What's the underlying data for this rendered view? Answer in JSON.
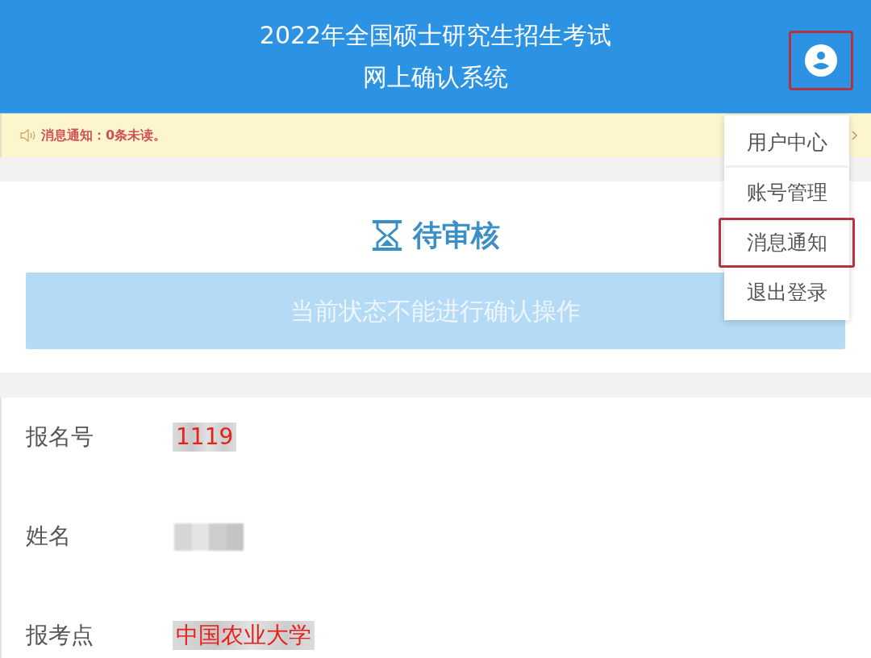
{
  "header": {
    "title_lines": [
      "2022年全国硕士研究生招生考试",
      "网上确认系统"
    ],
    "user_button": {
      "highlighted": true
    }
  },
  "notice": {
    "text": "消息通知：0条未读。"
  },
  "user_menu": {
    "items": [
      {
        "label": "用户中心",
        "highlighted": false
      },
      {
        "label": "账号管理",
        "highlighted": false
      },
      {
        "label": "消息通知",
        "highlighted": true
      },
      {
        "label": "退出登录",
        "highlighted": false
      }
    ]
  },
  "status": {
    "title": "待审核",
    "message": "当前状态不能进行确认操作"
  },
  "fields": [
    {
      "label": "报名号",
      "value": "1119",
      "redacted": true
    },
    {
      "label": "姓名",
      "redacted": true
    },
    {
      "label": "报考点",
      "value": "中国农业大学",
      "redacted": true
    }
  ]
}
